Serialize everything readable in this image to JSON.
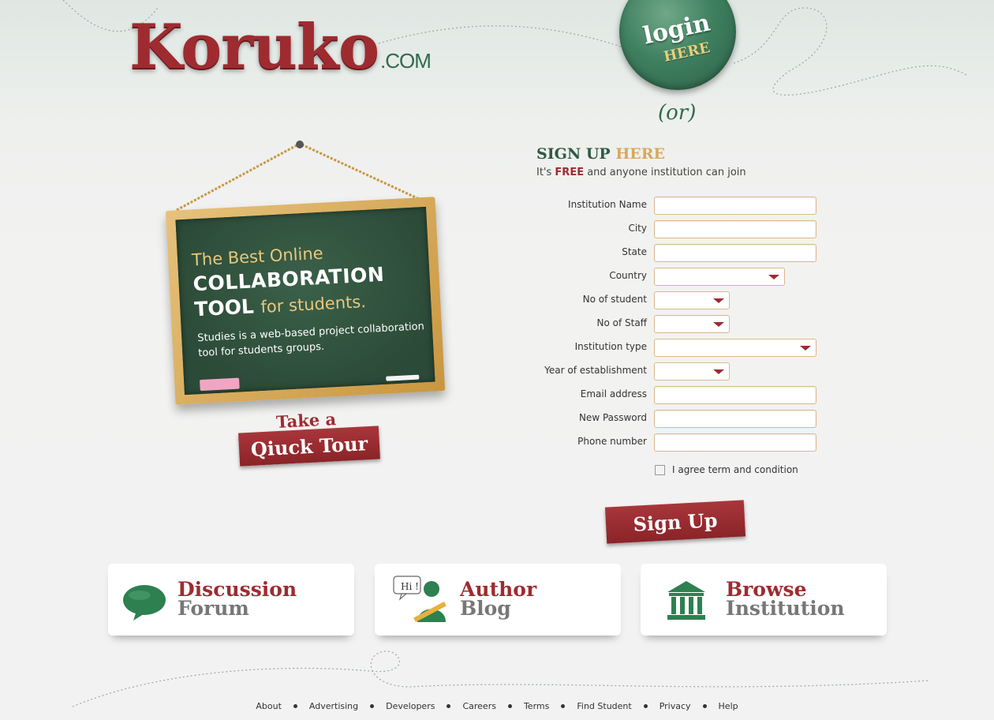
{
  "logo": {
    "word": "Koruko",
    "tld": ".COM"
  },
  "login": {
    "line1": "login",
    "line2": "HERE",
    "or": "(or)"
  },
  "chalkboard": {
    "line1": "The Best Online",
    "line2": "COLLABORATION",
    "line3_bold": "TOOL",
    "line3_rest": "for students.",
    "description": "Studies is a web-based project collaboration tool for students groups."
  },
  "tour": {
    "take": "Take a",
    "label": "Qiuck Tour"
  },
  "signup": {
    "title": "SIGN UP",
    "title_accent": "HERE",
    "sub_prefix": "It's",
    "sub_free": "FREE",
    "sub_suffix": "and anyone institution can join",
    "fields": {
      "institution_name": "Institution Name",
      "city": "City",
      "state": "State",
      "country": "Country",
      "no_of_student": "No of student",
      "no_of_staff": "No of Staff",
      "institution_type": "Institution type",
      "year_of_establishment": "Year of establishment",
      "email": "Email address",
      "password": "New Password",
      "phone": "Phone number"
    },
    "agree": "I agree term and condition",
    "button": "Sign Up"
  },
  "cards": [
    {
      "title1": "Discussion",
      "title2": "Forum",
      "icon": "speech-bubble-icon"
    },
    {
      "title1": "Author",
      "title2": "Blog",
      "icon": "author-pencil-icon",
      "bubble": "Hi !"
    },
    {
      "title1": "Browse",
      "title2": "Institution",
      "icon": "institution-building-icon"
    }
  ],
  "footer": [
    "About",
    "Advertising",
    "Developers",
    "Careers",
    "Terms",
    "Find Student",
    "Privacy",
    "Help"
  ],
  "colors": {
    "brand_red": "#9e2b30",
    "brand_green": "#2f6a4c",
    "accent_gold": "#d8a85c"
  }
}
